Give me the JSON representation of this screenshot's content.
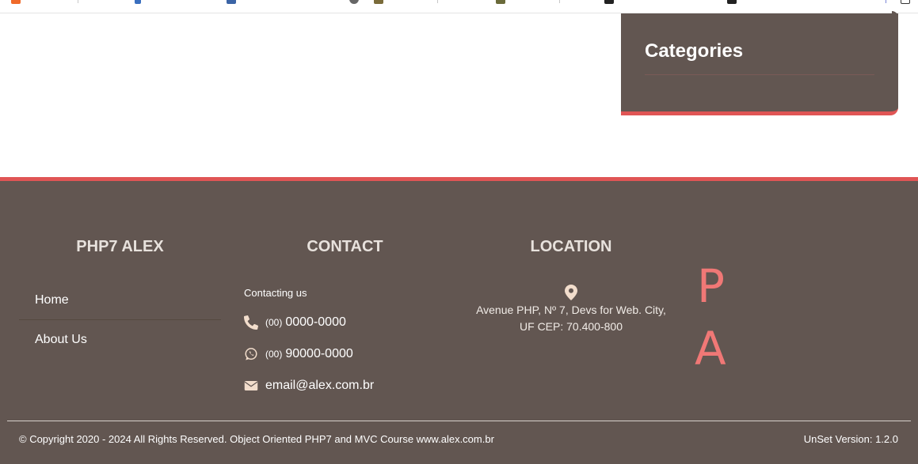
{
  "colors": {
    "accent": "#e05555",
    "panel_bg": "#625651",
    "icon": "#f2ddcc",
    "big_letters": "#f07876"
  },
  "sidebar": {
    "categories_title": "Categories"
  },
  "footer": {
    "brand_title": "PHP7 ALEX",
    "menu": [
      "Home",
      "About Us"
    ],
    "contact": {
      "title": "CONTACT",
      "intro": "Contacting us",
      "phone_area": "(00)",
      "phone_number": "0000-0000",
      "whatsapp_area": "(00)",
      "whatsapp_number": "90000-0000",
      "email": "email@alex.com.br"
    },
    "location": {
      "title": "LOCATION",
      "address_line1": "Avenue PHP, Nº 7, Devs for Web. City,",
      "address_line2": "UF CEP: 70.400-800"
    },
    "big_letters": [
      "P",
      "A"
    ],
    "copyright": "© Copyright 2020 - 2024 All Rights Reserved. Object Oriented PHP7 and MVC Course www.alex.com.br",
    "version": "UnSet Version: 1.2.0"
  }
}
